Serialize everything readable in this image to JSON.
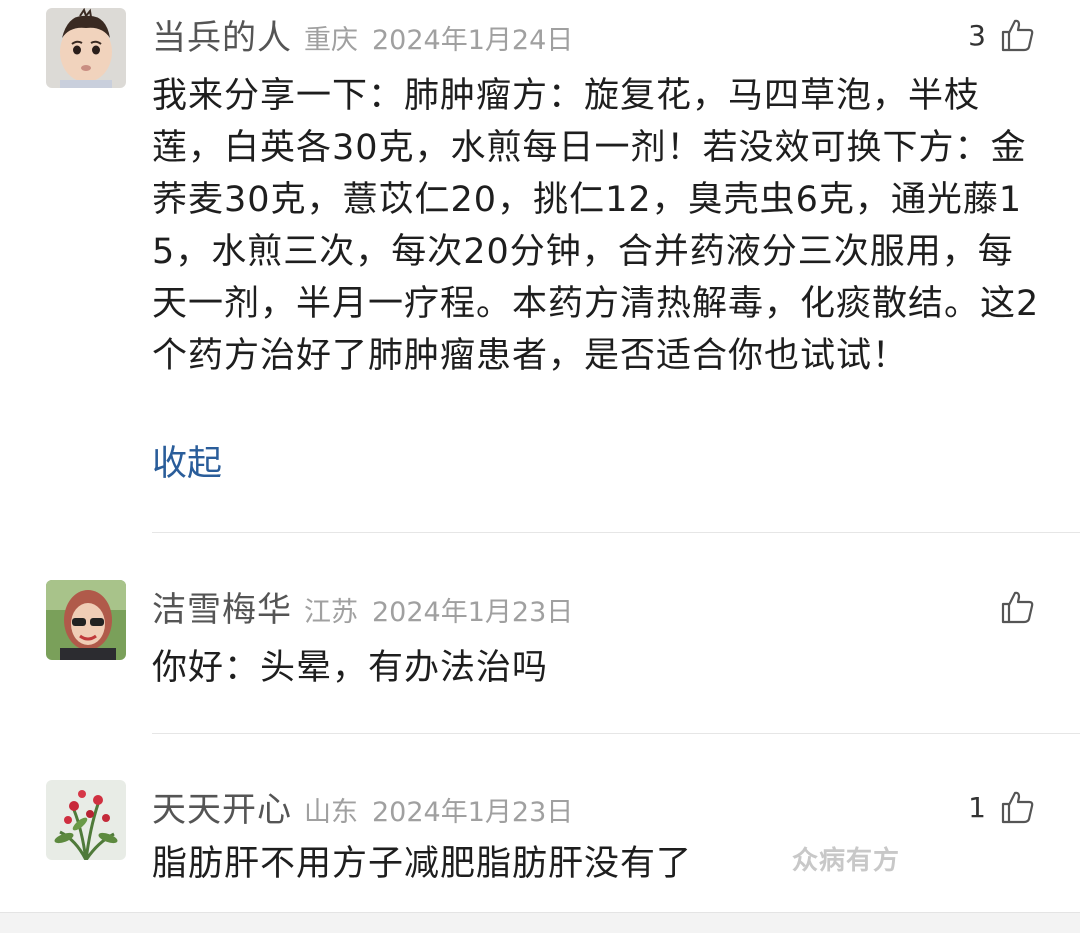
{
  "comments": [
    {
      "username": "当兵的人",
      "location": "重庆",
      "date": "2024年1月24日",
      "likes": "3",
      "avatar_icon": "baby-face-avatar",
      "text": "我来分享一下：肺肿瘤方：旋复花，马四草泡，半枝莲，白英各30克，水煎每日一剂！若没效可换下方：金荞麦30克，薏苡仁20，挑仁12，臭壳虫6克，通光藤15，水煎三次，每次20分钟，合并药液分三次服用，每天一剂，半月一疗程。本药方清热解毒，化痰散结。这2个药方治好了肺肿瘤患者，是否适合你也试试！",
      "collapse_label": "收起"
    },
    {
      "username": "洁雪梅华",
      "location": "江苏",
      "date": "2024年1月23日",
      "likes": "",
      "avatar_icon": "woman-sunglasses-avatar",
      "text": "你好：头晕，有办法治吗"
    },
    {
      "username": "天天开心",
      "location": "山东",
      "date": "2024年1月23日",
      "likes": "1",
      "avatar_icon": "red-flowers-avatar",
      "text": "脂肪肝不用方子减肥脂肪肝没有了"
    }
  ],
  "watermark": "众病有方",
  "like_icon": "thumbs-up-icon",
  "colors": {
    "username": "#555555",
    "meta": "#a0a0a0",
    "link": "#2a5d9a",
    "divider": "#e6e6e6"
  }
}
